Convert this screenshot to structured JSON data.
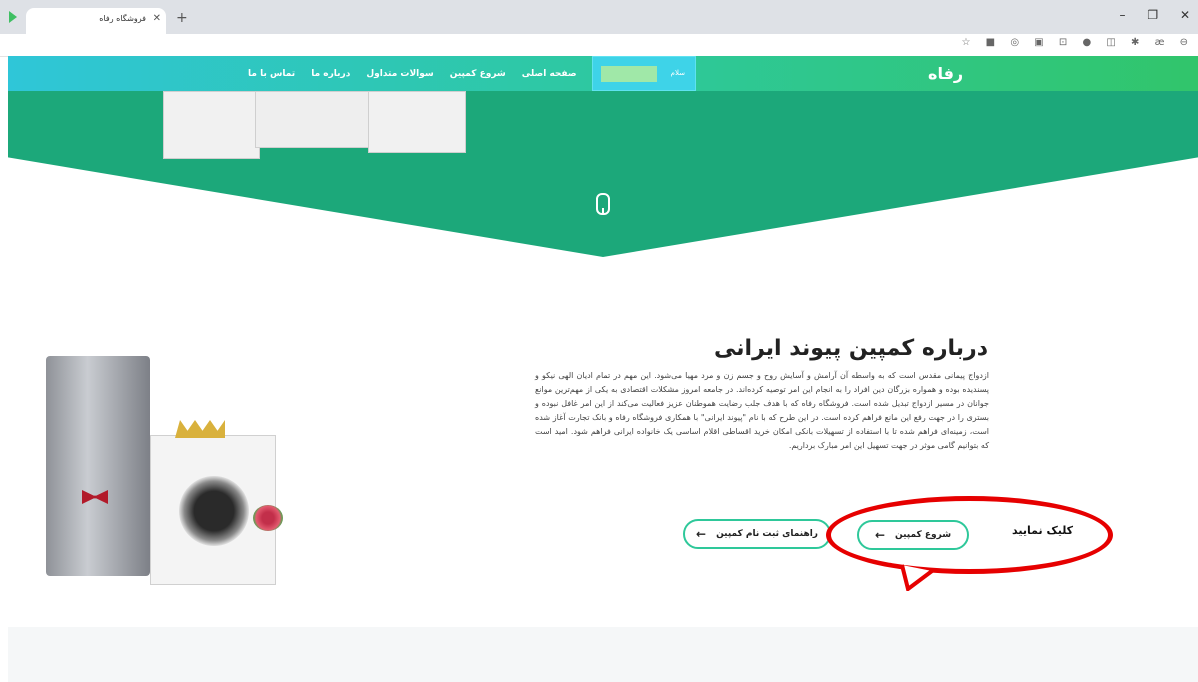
{
  "browser": {
    "tab_title": "فروشگاه رفاه",
    "tab_close": "✕",
    "new_tab": "+",
    "window_minimize": "–",
    "window_maximize": "❐",
    "window_close": "✕"
  },
  "toolbar_icons": [
    "☆",
    "■",
    "◎",
    "▣",
    "⊡",
    "●",
    "◫",
    "✱",
    "æ",
    "⊖"
  ],
  "nav": {
    "logo": "رفاه",
    "user_greeting": "سلام",
    "links": [
      "صفحه اصلی",
      "شروع کمپین",
      "سوالات متداول",
      "درباره ما",
      "تماس با ما"
    ]
  },
  "about": {
    "title": "درباره کمپین پیوند ایرانی",
    "body": "ازدواج پیمانی مقدس است که به واسطه آن آرامش و آسایش روح و جسم زن و مرد مهیا می‌شود. این مهم در تمام ادیان الهی نیکو و پسندیده بوده و همواره بزرگان دین افراد را به انجام این امر توصیه کرده‌اند. در جامعه امروز مشکلات اقتصادی به یکی از مهم‌ترین موانع جوانان در مسیر ازدواج تبدیل شده است. فروشگاه رفاه که با هدف جلب رضایت هموطنان عزیز فعالیت می‌کند از این امر غافل نبوده و بستری را در جهت رفع این مانع فراهم کرده است. در این طرح که با نام \"پیوند ایرانی\" با همکاری فروشگاه رفاه و بانک تجارت آغاز شده است، زمینه‌ای فراهم شده تا با استفاده از تسهیلات بانکی امکان خرید اقساطی اقلام اساسی یک خانواده ایرانی فراهم شود. امید است که بتوانیم گامی موثر در جهت تسهیل این امر مبارک برداریم."
  },
  "buttons": {
    "start": "شروع کمپین",
    "guide": "راهنمای ثبت نام کمپین",
    "arrow": "←"
  },
  "annotation": {
    "label": "کلیک نمایید",
    "color": "#e60000"
  },
  "colors": {
    "brand_green": "#1ca87a",
    "nav_start": "#2fc6d8",
    "nav_end": "#31c56b"
  }
}
